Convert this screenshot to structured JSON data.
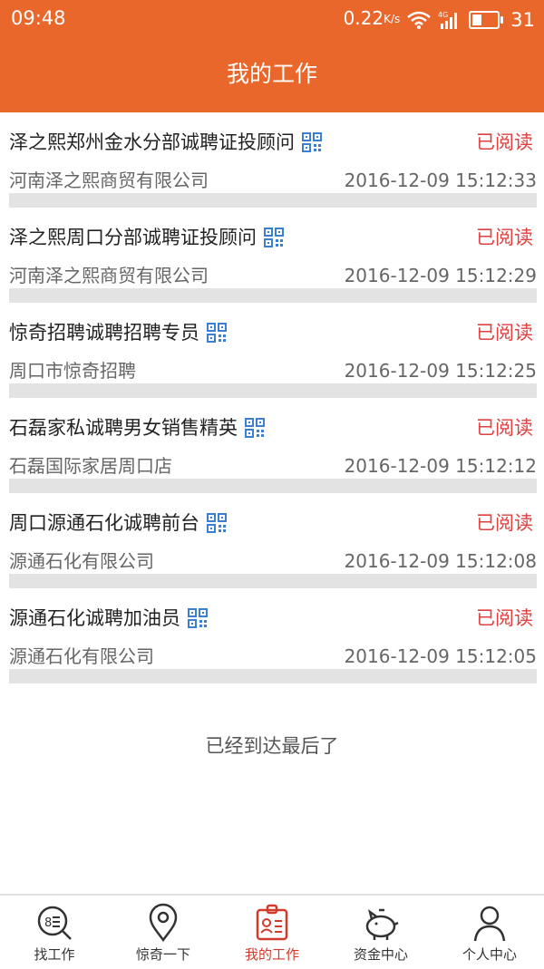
{
  "status": {
    "time": "09:48",
    "net_speed": "0.22",
    "net_unit": "K/s",
    "network_type": "4G",
    "battery": "31"
  },
  "header": {
    "title": "我的工作"
  },
  "colors": {
    "header_bg": "#e9672b",
    "read_status": "#e04040",
    "active_tab": "#d23b2b",
    "qr_icon": "#3b7fd4"
  },
  "items": [
    {
      "job": "泽之熙郑州金水分部诚聘证投顾问",
      "company": "河南泽之熙商贸有限公司",
      "time": "2016-12-09 15:12:33",
      "status": "已阅读"
    },
    {
      "job": "泽之熙周口分部诚聘证投顾问",
      "company": "河南泽之熙商贸有限公司",
      "time": "2016-12-09 15:12:29",
      "status": "已阅读"
    },
    {
      "job": "惊奇招聘诚聘招聘专员",
      "company": "周口市惊奇招聘",
      "time": "2016-12-09 15:12:25",
      "status": "已阅读"
    },
    {
      "job": "石磊家私诚聘男女销售精英",
      "company": "石磊国际家居周口店",
      "time": "2016-12-09 15:12:12",
      "status": "已阅读"
    },
    {
      "job": "周口源通石化诚聘前台",
      "company": "源通石化有限公司",
      "time": "2016-12-09 15:12:08",
      "status": "已阅读"
    },
    {
      "job": "源通石化诚聘加油员",
      "company": "源通石化有限公司",
      "time": "2016-12-09 15:12:05",
      "status": "已阅读"
    }
  ],
  "end_text": "已经到达最后了",
  "nav": [
    {
      "label": "找工作",
      "icon": "search-job-icon"
    },
    {
      "label": "惊奇一下",
      "icon": "location-pin-icon"
    },
    {
      "label": "我的工作",
      "icon": "id-badge-icon",
      "active": true
    },
    {
      "label": "资金中心",
      "icon": "piggy-bank-icon"
    },
    {
      "label": "个人中心",
      "icon": "person-icon"
    }
  ]
}
